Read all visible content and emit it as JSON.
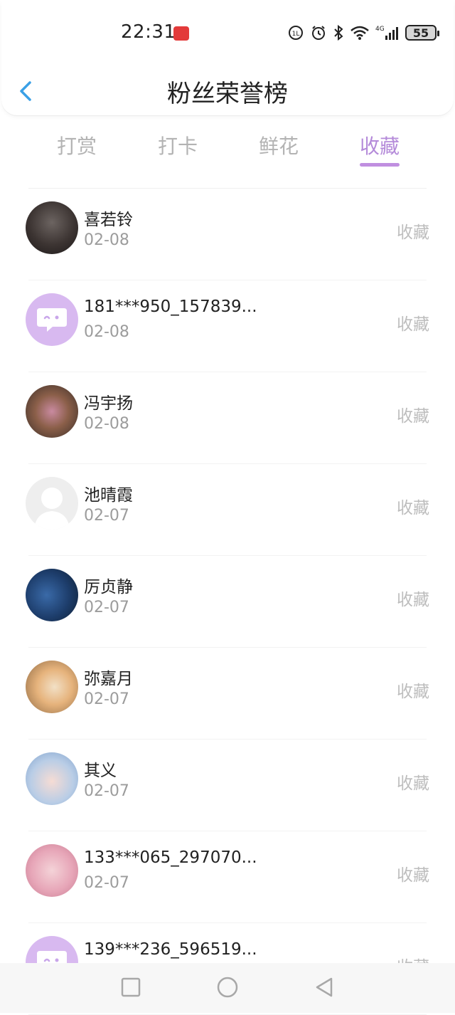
{
  "status_bar": {
    "time": "22:31",
    "battery": "55",
    "network": "4G"
  },
  "header": {
    "title": "粉丝荣誉榜",
    "back_icon": "chevron-left-icon"
  },
  "tabs": [
    {
      "label": "打赏",
      "active": false
    },
    {
      "label": "打卡",
      "active": false
    },
    {
      "label": "鲜花",
      "active": false
    },
    {
      "label": "收藏",
      "active": true
    }
  ],
  "list": [
    {
      "name": "喜若铃",
      "date": "02-08",
      "action": "收藏"
    },
    {
      "name": "181***950_157839...",
      "date": "02-08",
      "action": "收藏"
    },
    {
      "name": "冯宇扬",
      "date": "02-08",
      "action": "收藏"
    },
    {
      "name": "池晴霞",
      "date": "02-07",
      "action": "收藏"
    },
    {
      "name": "厉贞静",
      "date": "02-07",
      "action": "收藏"
    },
    {
      "name": "弥嘉月",
      "date": "02-07",
      "action": "收藏"
    },
    {
      "name": "其义",
      "date": "02-07",
      "action": "收藏"
    },
    {
      "name": "133***065_297070...",
      "date": "02-07",
      "action": "收藏"
    },
    {
      "name": "139***236_596519...",
      "date": "",
      "action": "收藏"
    }
  ],
  "colors": {
    "accent": "#b48ad9",
    "tab_inactive": "#b3b3b3",
    "action_text": "#bdbdbd",
    "back_icon": "#3aa0e6"
  },
  "bottom_nav": {
    "items": [
      "square-icon",
      "circle-icon",
      "triangle-back-icon"
    ]
  }
}
